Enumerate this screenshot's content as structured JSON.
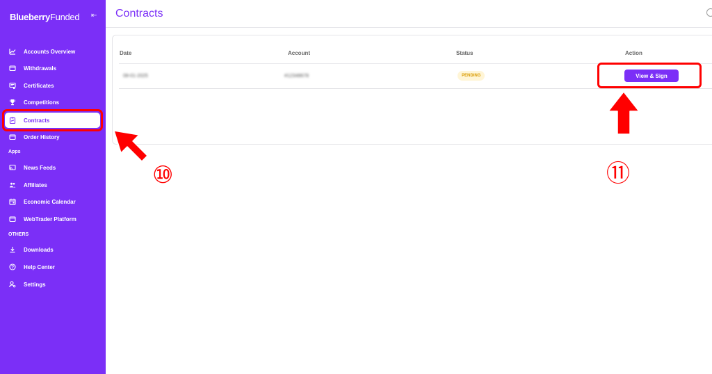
{
  "brand": {
    "bold": "Blueberry",
    "light": "Funded"
  },
  "sidebar": {
    "items": [
      {
        "label": "Accounts Overview",
        "icon": "chart-line-icon"
      },
      {
        "label": "Withdrawals",
        "icon": "folder-icon"
      },
      {
        "label": "Certificates",
        "icon": "certificate-icon"
      },
      {
        "label": "Competitions",
        "icon": "trophy-icon"
      },
      {
        "label": "Contracts",
        "icon": "contract-icon"
      },
      {
        "label": "Order History",
        "icon": "folder-icon"
      }
    ],
    "apps_label": "Apps",
    "apps": [
      {
        "label": "News Feeds",
        "icon": "cast-icon"
      },
      {
        "label": "Affiliates",
        "icon": "people-icon"
      },
      {
        "label": "Economic Calendar",
        "icon": "calendar-icon"
      },
      {
        "label": "WebTrader Platform",
        "icon": "folder-icon"
      }
    ],
    "others_label": "OTHERS",
    "others": [
      {
        "label": "Downloads",
        "icon": "download-icon"
      },
      {
        "label": "Help Center",
        "icon": "help-icon"
      },
      {
        "label": "Settings",
        "icon": "settings-icon"
      }
    ]
  },
  "header": {
    "title": "Contracts"
  },
  "table": {
    "columns": [
      "Date",
      "Account",
      "Status",
      "Action"
    ],
    "rows": [
      {
        "date": "08-01-2025",
        "account": "#12348678",
        "status": "PENDING",
        "action": "View & Sign"
      }
    ]
  },
  "annotations": {
    "step_a": "⑩",
    "step_b": "⑪"
  },
  "colors": {
    "brand": "#7b2ff7",
    "highlight": "#ff0000",
    "pending_bg": "#fff5d6",
    "pending_text": "#d99a00"
  }
}
